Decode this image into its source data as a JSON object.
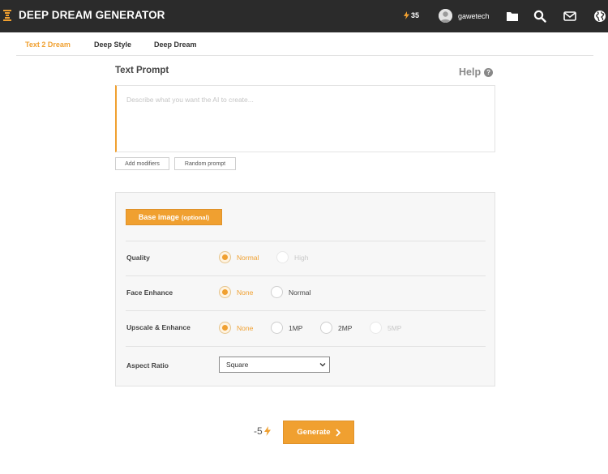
{
  "header": {
    "brand": "DEEP DREAM GENERATOR",
    "credits": "35",
    "username": "gawetech",
    "icons": [
      "folder-icon",
      "search-icon",
      "mail-icon",
      "globe-icon"
    ]
  },
  "tabs": [
    {
      "label": "Text 2 Dream",
      "active": true
    },
    {
      "label": "Deep Style",
      "active": false
    },
    {
      "label": "Deep Dream",
      "active": false
    }
  ],
  "prompt": {
    "title": "Text Prompt",
    "help": "Help",
    "placeholder": "Describe what you want the AI to create...",
    "value": "",
    "add_modifiers": "Add modifiers",
    "random_prompt": "Random prompt"
  },
  "options": {
    "base_image_label": "Base image",
    "base_image_optional": "(optional)",
    "quality": {
      "label": "Quality",
      "options": [
        "Normal",
        "High"
      ],
      "selected": "Normal"
    },
    "face_enhance": {
      "label": "Face Enhance",
      "options": [
        "None",
        "Normal"
      ],
      "selected": "None"
    },
    "upscale": {
      "label": "Upscale & Enhance",
      "options": [
        "None",
        "1MP",
        "2MP",
        "5MP"
      ],
      "selected": "None"
    },
    "aspect_ratio": {
      "label": "Aspect Ratio",
      "value": "Square"
    }
  },
  "generate": {
    "cost": "-5",
    "label": "Generate"
  },
  "colors": {
    "accent": "#f0a030",
    "topbar": "#2b2b2b",
    "panel_bg": "#f7f7f7"
  }
}
